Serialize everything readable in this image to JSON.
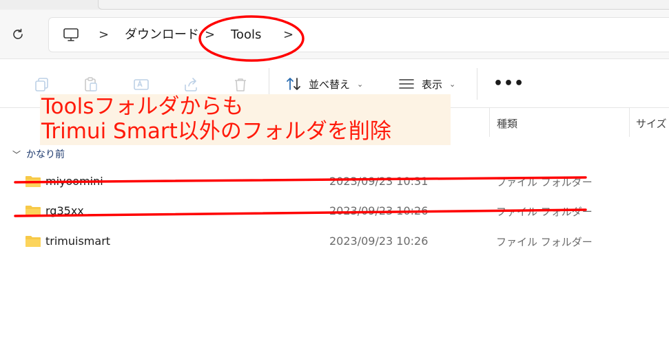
{
  "breadcrumb": {
    "items": [
      "ダウンロード",
      "Tools"
    ],
    "separator": ">"
  },
  "toolbar": {
    "sort_label": "並べ替え",
    "view_label": "表示",
    "more_label": "•••"
  },
  "columns": {
    "type": "種類",
    "size": "サイズ"
  },
  "group": {
    "label": "かなり前"
  },
  "files": [
    {
      "name": "miyoomini",
      "date": "2023/09/23 10:31",
      "type": "ファイル フォルダー"
    },
    {
      "name": "rg35xx",
      "date": "2023/09/23 10:26",
      "type": "ファイル フォルダー"
    },
    {
      "name": "trimuismart",
      "date": "2023/09/23 10:26",
      "type": "ファイル フォルダー"
    }
  ],
  "annotation": {
    "line1": "Toolsフォルダからも",
    "line2": "Trimui Smart以外のフォルダを削除",
    "color": "#ff0000"
  },
  "colors": {
    "folder": "#f7c948",
    "annotation_bg": "#fdf3e4",
    "group_text": "#1e3a6e"
  }
}
